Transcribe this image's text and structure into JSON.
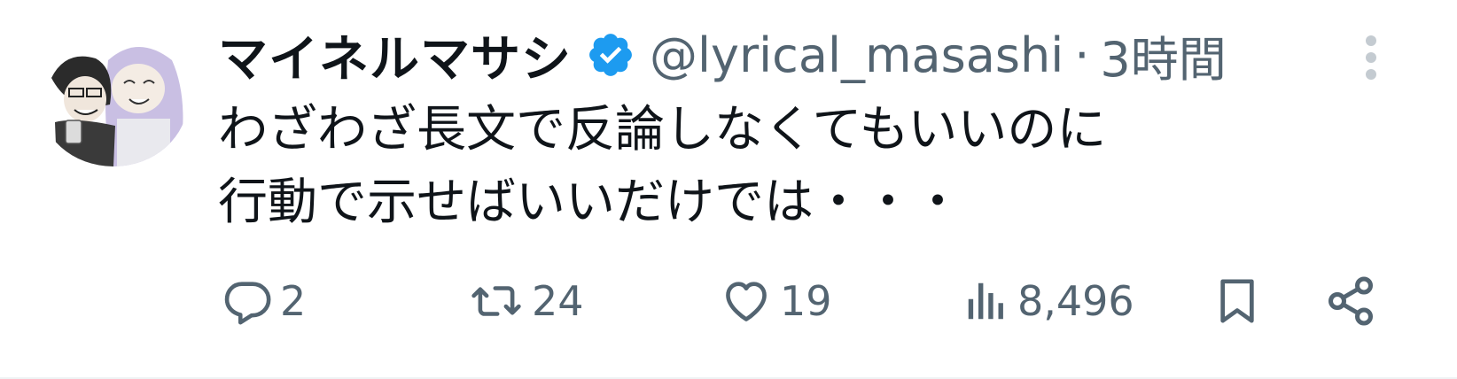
{
  "tweet": {
    "display_name": "マイネルマサシ",
    "handle": "@lyrical_masashi",
    "separator": "·",
    "time": "3時間",
    "text_lines": [
      "わざわざ長文で反論しなくてもいいのに",
      "行動で示せばいいだけでは・・・"
    ]
  },
  "actions": {
    "replies": "2",
    "retweets": "24",
    "likes": "19",
    "views": "8,496"
  },
  "icons": {
    "verified": "verified-badge-icon",
    "more": "more-options-icon",
    "reply": "reply-icon",
    "retweet": "retweet-icon",
    "like": "heart-icon",
    "views": "views-chart-icon",
    "bookmark": "bookmark-icon",
    "share": "share-icon"
  },
  "colors": {
    "text_primary": "#0f1419",
    "text_secondary": "#536471",
    "verified_blue": "#1d9bf0"
  }
}
